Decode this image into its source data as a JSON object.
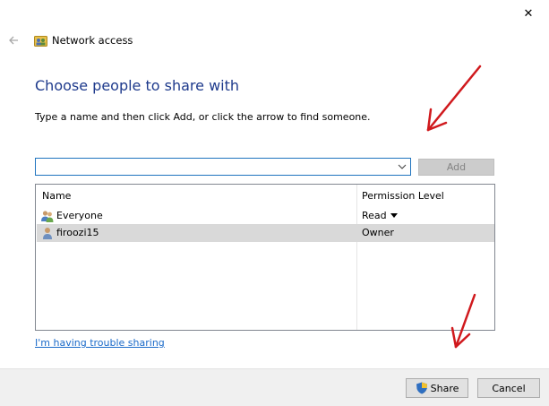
{
  "window": {
    "title": "Network access",
    "close_glyph": "✕",
    "back_glyph": "←"
  },
  "main": {
    "heading": "Choose people to share with",
    "instruction": "Type a name and then click Add, or click the arrow to find someone.",
    "name_input": {
      "value": "",
      "placeholder": ""
    },
    "add_label": "Add"
  },
  "list": {
    "columns": [
      "Name",
      "Permission Level"
    ],
    "rows": [
      {
        "name": "Everyone",
        "permission": "Read",
        "icon": "group-icon",
        "has_dropdown": true,
        "selected": false
      },
      {
        "name": "firoozi15",
        "permission": "Owner",
        "icon": "user-icon",
        "has_dropdown": false,
        "selected": true
      }
    ]
  },
  "help_link": "I'm having trouble sharing",
  "footer": {
    "share_label": "Share",
    "cancel_label": "Cancel"
  },
  "colors": {
    "heading": "#1e3a8c",
    "link": "#1a6ac9",
    "annotation_arrow": "#d0191d",
    "selected_row": "#d9d9d9"
  }
}
